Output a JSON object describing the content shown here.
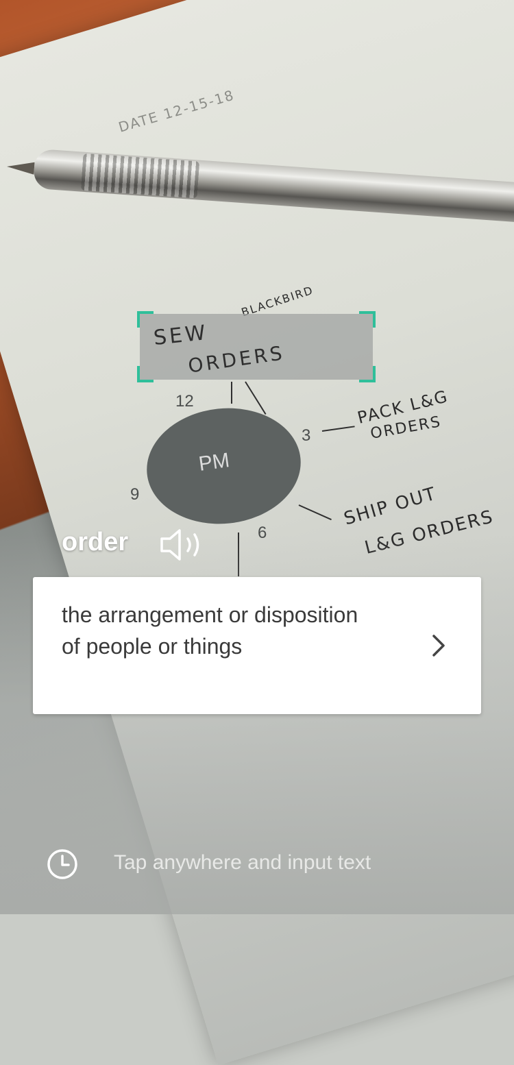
{
  "scan": {
    "captured_line_1": "SEW",
    "captured_line_2": "ORDERS"
  },
  "result": {
    "word": "order",
    "definition": "the arrangement or disposition of people or things"
  },
  "background_notes": {
    "date_label": "DATE 12-15-18",
    "top_note": "BLACKBIRD",
    "clock_center": "PM",
    "clock_numbers": [
      "12",
      "3",
      "6",
      "9"
    ],
    "note_right_1": "PACK L&G",
    "note_right_2": "ORDERS",
    "note_right_3": "SHIP OUT",
    "note_right_4": "L&G ORDERS"
  },
  "bottom_bar": {
    "input_hint": "Tap anywhere and input text"
  },
  "icons": {
    "speaker": "speaker-icon",
    "chevron": "chevron-right-icon",
    "history": "clock-history-icon"
  },
  "colors": {
    "accent": "#2fbf9a",
    "card_bg": "#ffffff",
    "card_text": "#3a3a3a",
    "overlay_text": "#ffffff"
  }
}
